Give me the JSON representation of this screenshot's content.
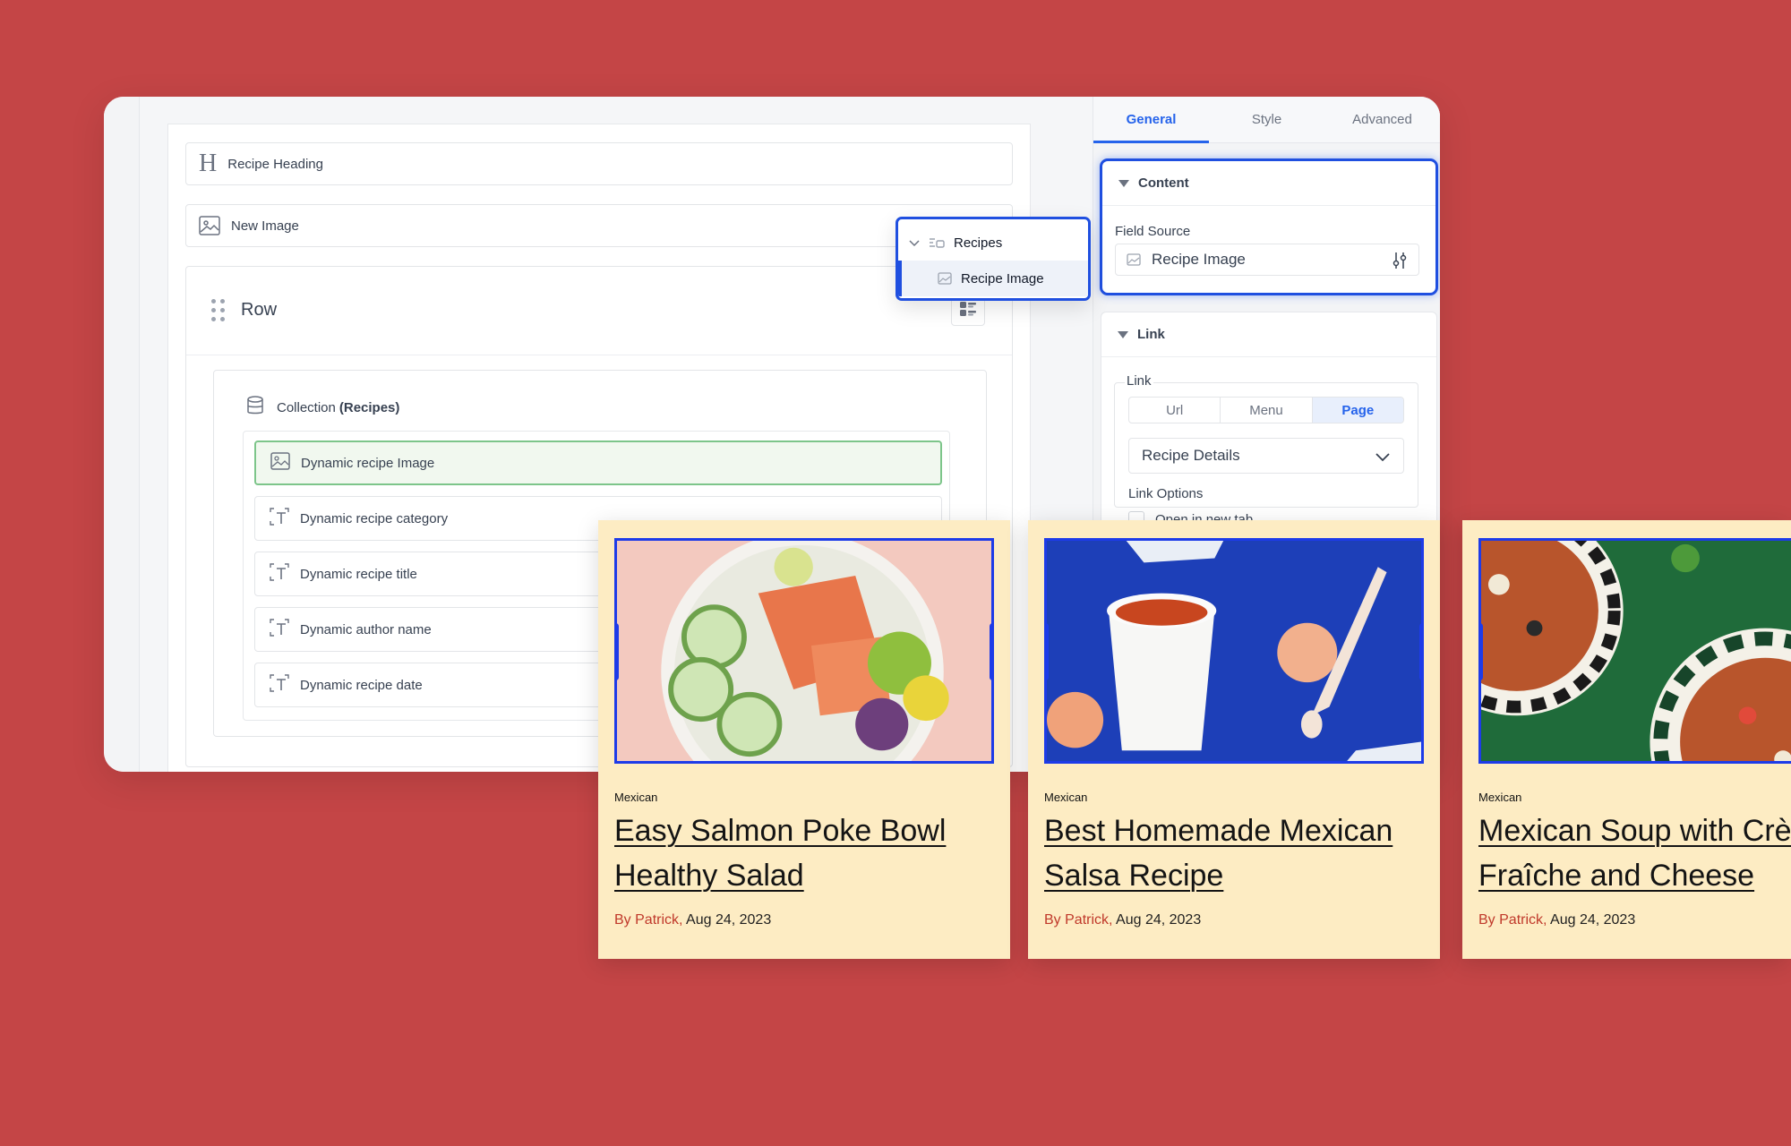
{
  "canvas": {
    "blocks": [
      {
        "label": "Recipe Heading"
      },
      {
        "label": "New Image"
      }
    ],
    "row": {
      "title": "Row",
      "collection": {
        "label": "Collection ",
        "label_bold": "(Recipes)",
        "items": [
          {
            "label": "Dynamic recipe Image",
            "active": true
          },
          {
            "label": "Dynamic recipe category"
          },
          {
            "label": "Dynamic recipe title"
          },
          {
            "label": "Dynamic author name"
          },
          {
            "label": "Dynamic recipe date"
          }
        ]
      }
    }
  },
  "field_popover": {
    "group": "Recipes",
    "selected": "Recipe Image"
  },
  "panel": {
    "tabs": [
      "General",
      "Style",
      "Advanced"
    ],
    "active_tab": "General",
    "content": {
      "heading": "Content",
      "field_source_label": "Field Source",
      "field_source_value": "Recipe Image"
    },
    "link": {
      "heading": "Link",
      "legend": "Link",
      "types": [
        "Url",
        "Menu",
        "Page"
      ],
      "active_type": "Page",
      "page_value": "Recipe Details",
      "options_label": "Link Options",
      "option_text": "Open in new tab"
    }
  },
  "cards": [
    {
      "category": "Mexican",
      "title_line1": "Easy Salmon Poke Bowl ",
      "title_line2": "Healthy Salad",
      "author": "By Patrick,",
      "date": "Aug 24, 2023"
    },
    {
      "category": "Mexican",
      "title_line1": "Best Homemade Mexican",
      "title_line2": "Salsa Recipe",
      "author": "By Patrick,",
      "date": "Aug 24, 2023"
    },
    {
      "category": "Mexican",
      "title_line1": "Mexican Soup with Crè",
      "title_line2": "Fraîche and Cheese",
      "author": "By Patrick,",
      "date": "Aug 24, 2023"
    }
  ],
  "colors": {
    "background": "#c44546",
    "accent_blue": "#1f4fe0",
    "card_bg": "#fdecc3",
    "author_red": "#c0392b",
    "active_item_green": "#7dc58a"
  },
  "icons": {
    "heading": "heading-icon",
    "image": "image-icon",
    "database": "database-icon",
    "dynamic_image": "dynamic-image-icon",
    "dynamic_text": "dynamic-text-icon",
    "collection_group": "collection-icon",
    "adjust": "adjust-icon",
    "chevron": "chevron-down-icon",
    "drag": "drag-handle-icon",
    "layout": "layout-icon"
  }
}
